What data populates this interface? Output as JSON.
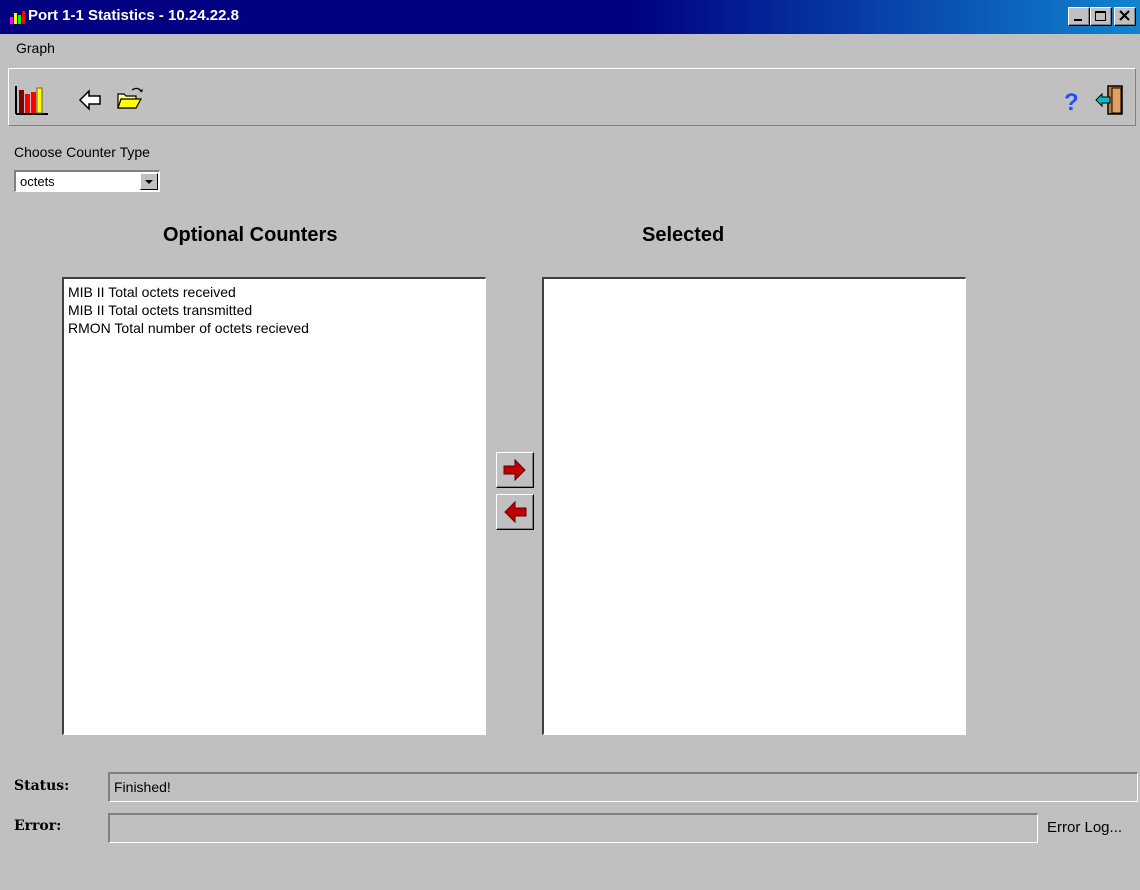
{
  "window": {
    "title": "Port 1-1 Statistics - 10.24.22.8",
    "controls": [
      "minimize",
      "maximize",
      "close"
    ]
  },
  "menu": {
    "items": [
      {
        "label": "Graph"
      }
    ]
  },
  "toolbar": {
    "left_icons": [
      "bar-chart-icon",
      "back-arrow-icon",
      "open-folder-icon"
    ],
    "right_icons": [
      "help-icon",
      "exit-door-icon"
    ],
    "help_glyph": "?"
  },
  "counter_type": {
    "label": "Choose Counter Type",
    "selected": "octets"
  },
  "optional_counters": {
    "heading": "Optional Counters",
    "items": [
      "MIB II  Total octets received",
      "MIB II  Total octets transmitted",
      "RMON Total number of octets recieved"
    ]
  },
  "selected_counters": {
    "heading": "Selected",
    "items": []
  },
  "move_buttons": {
    "add_icon": "right-arrow-icon",
    "remove_icon": "left-arrow-icon"
  },
  "status": {
    "label": "Status:",
    "value": "Finished!"
  },
  "error": {
    "label": "Error:",
    "value": "",
    "log_link": "Error Log..."
  },
  "colors": {
    "title_bar": "#000080",
    "face": "#c0c0c0",
    "arrow_red": "#c00000",
    "bar_yellow": "#ffff00",
    "bar_red": "#ff0000",
    "bar_dark": "#800000"
  }
}
